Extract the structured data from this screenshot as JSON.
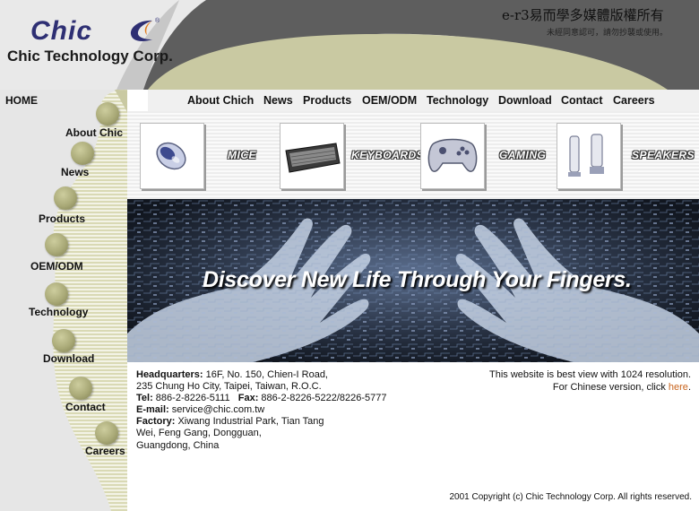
{
  "header": {
    "logo_word": "Chic",
    "company": "Chic Technology Corp.",
    "brand_cn": "e-r3易而學多媒體版權所有",
    "brand_cn_sub": "未經同意認可，請勿抄襲或使用。"
  },
  "side_nav": {
    "items": [
      {
        "label": "HOME"
      },
      {
        "label": "About Chic"
      },
      {
        "label": "News"
      },
      {
        "label": "Products"
      },
      {
        "label": "OEM/ODM"
      },
      {
        "label": "Technology"
      },
      {
        "label": "Download"
      },
      {
        "label": "Contact"
      },
      {
        "label": "Careers"
      }
    ]
  },
  "top_nav": {
    "items": [
      {
        "label": "About Chich"
      },
      {
        "label": "News"
      },
      {
        "label": "Products"
      },
      {
        "label": "OEM/ODM"
      },
      {
        "label": "Technology"
      },
      {
        "label": "Download"
      },
      {
        "label": "Contact"
      },
      {
        "label": "Careers"
      }
    ]
  },
  "products": [
    {
      "label": "MICE",
      "icon": "mouse-icon"
    },
    {
      "label": "KEYBOARDS",
      "icon": "keyboard-icon"
    },
    {
      "label": "GAMING",
      "icon": "gamepad-icon"
    },
    {
      "label": "SPEAKERS",
      "icon": "speakers-icon"
    }
  ],
  "banner": {
    "tagline": "Discover New Life Through Your Fingers."
  },
  "contact": {
    "hq_label": "Headquarters:",
    "hq_line1": " 16F, No. 150, Chien-I Road,",
    "hq_line2": "235 Chung Ho City, Taipei, Taiwan, R.O.C.",
    "tel_label": "Tel:",
    "tel_value": " 886-2-8226-5111",
    "fax_label": "Fax:",
    "fax_value": " 886-2-8226-5222/8226-5777",
    "email_label": "E-mail:",
    "email_value": " service@chic.com.tw",
    "factory_label": "Factory:",
    "factory_line1": " Xiwang Industrial Park, Tian Tang",
    "factory_line2": "Wei, Feng Gang, Dongguan,",
    "factory_line3": "Guangdong, China"
  },
  "notes": {
    "resolution": "This website is best view with 1024 resolution.",
    "chinese_prefix": "For Chinese version, click ",
    "here": "here",
    "chinese_suffix": "."
  },
  "footer": {
    "copyright": "2001 Copyright (c) Chic Technology Corp. All rights reserved."
  },
  "colors": {
    "logo_navy": "#2e2f73",
    "header_dark": "#5a5a5a",
    "olive_arc": "#c9c9a2",
    "link_orange": "#c8641e"
  }
}
